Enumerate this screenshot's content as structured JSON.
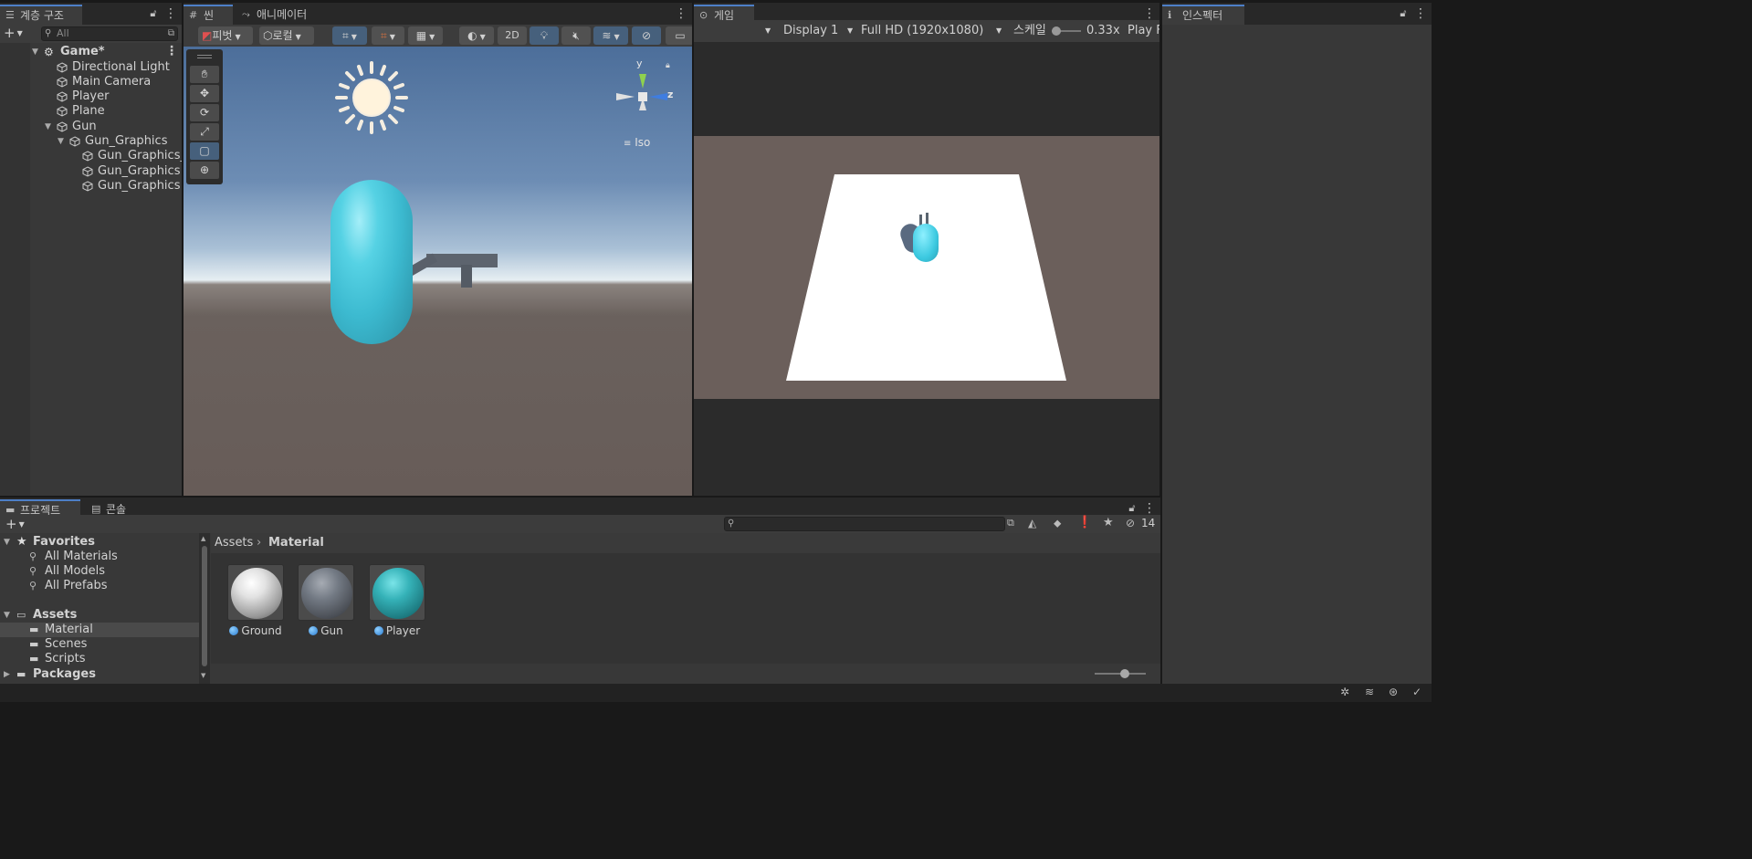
{
  "hierarchy": {
    "tab_label": "계층 구조",
    "search_placeholder": "All",
    "scene_name": "Game*",
    "items": [
      {
        "label": "Directional Light"
      },
      {
        "label": "Main Camera"
      },
      {
        "label": "Player"
      },
      {
        "label": "Plane"
      },
      {
        "label": "Gun"
      },
      {
        "label": "Gun_Graphics"
      },
      {
        "label": "Gun_Graphics_"
      },
      {
        "label": "Gun_Graphics"
      },
      {
        "label": "Gun_Graphics"
      }
    ]
  },
  "scene_view": {
    "tab_scene": "씬",
    "tab_animator": "애니메이터",
    "pivot_label": "피벗",
    "local_label": "로컬",
    "mode_2d_label": "2D",
    "projection_label": "Iso",
    "gizmo_y": "y",
    "gizmo_z": "z"
  },
  "game_view": {
    "tab_label": "게임",
    "display": "Display 1",
    "resolution": "Full HD (1920x1080)",
    "scale_label": "스케일",
    "scale_value": "0.33x",
    "play_label": "Play F"
  },
  "inspector": {
    "tab_label": "인스펙터"
  },
  "project": {
    "tab_project": "프로젝트",
    "tab_console": "콘솔",
    "hidden_count": "14",
    "favorites_label": "Favorites",
    "favorites": [
      "All Materials",
      "All Models",
      "All Prefabs"
    ],
    "assets_label": "Assets",
    "asset_folders": [
      "Material",
      "Scenes",
      "Scripts"
    ],
    "packages_label": "Packages",
    "breadcrumb_root": "Assets",
    "breadcrumb_current": "Material",
    "materials": [
      {
        "name": "Ground",
        "color": "#d8d8d8"
      },
      {
        "name": "Gun",
        "color": "#6b7079"
      },
      {
        "name": "Player",
        "color": "#2fb3b8"
      }
    ]
  },
  "colors": {
    "accent": "#4d7fc7",
    "panel_bg": "#383838",
    "toolbar_bg": "#3c3c3c",
    "player_cyan": "#3ec7dc"
  }
}
